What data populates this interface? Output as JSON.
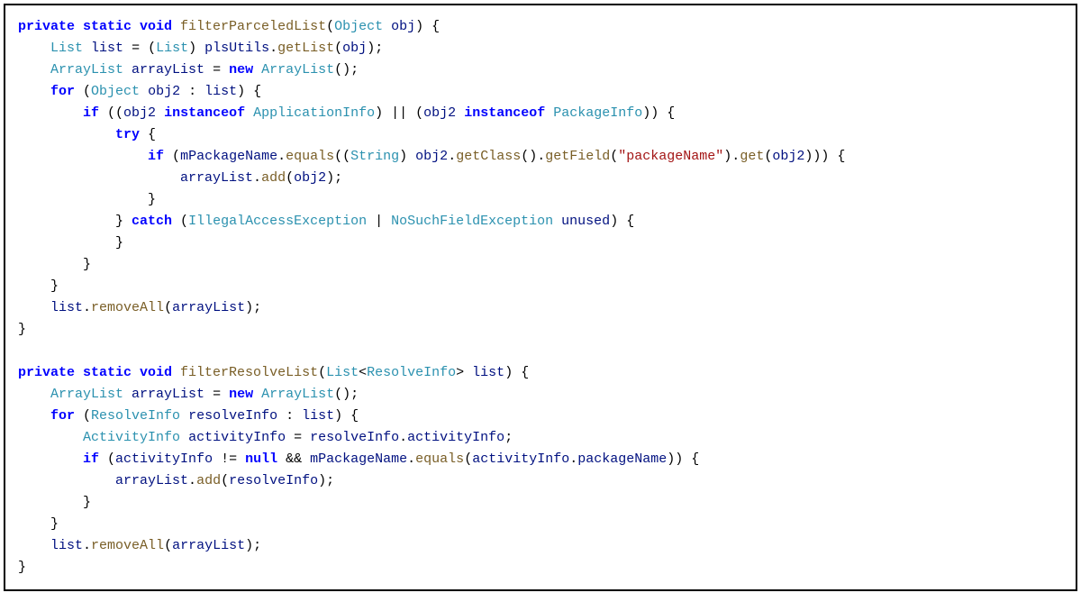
{
  "code": {
    "method1": {
      "modifiers": "private static void",
      "name": "filterParceledList",
      "param_type": "Object",
      "param_name": "obj",
      "line1_type1": "List",
      "line1_var": "list",
      "line1_cast": "List",
      "line1_call": "plsUtils",
      "line1_method": "getList",
      "line1_arg": "obj",
      "line2_type": "ArrayList",
      "line2_var": "arrayList",
      "line2_new": "new",
      "line2_ctor": "ArrayList",
      "for_kw": "for",
      "for_type": "Object",
      "for_var": "obj2",
      "for_in": "list",
      "if1_kw": "if",
      "if1_var1": "obj2",
      "if1_inst": "instanceof",
      "if1_type1": "ApplicationInfo",
      "if1_var2": "obj2",
      "if1_type2": "PackageInfo",
      "try_kw": "try",
      "if2_kw": "if",
      "if2_field": "mPackageName",
      "if2_method1": "equals",
      "if2_cast": "String",
      "if2_var": "obj2",
      "if2_method2": "getClass",
      "if2_method3": "getField",
      "if2_str": "\"packageName\"",
      "if2_method4": "get",
      "if2_arg": "obj2",
      "add_var": "arrayList",
      "add_method": "add",
      "add_arg": "obj2",
      "catch_kw": "catch",
      "catch_ex1": "IllegalAccessException",
      "catch_ex2": "NoSuchFieldException",
      "catch_var": "unused",
      "remove_var": "list",
      "remove_method": "removeAll",
      "remove_arg": "arrayList"
    },
    "method2": {
      "modifiers": "private static void",
      "name": "filterResolveList",
      "param_type": "List",
      "param_gen": "ResolveInfo",
      "param_name": "list",
      "line1_type": "ArrayList",
      "line1_var": "arrayList",
      "line1_new": "new",
      "line1_ctor": "ArrayList",
      "for_kw": "for",
      "for_type": "ResolveInfo",
      "for_var": "resolveInfo",
      "for_in": "list",
      "line2_type": "ActivityInfo",
      "line2_var": "activityInfo",
      "line2_src": "resolveInfo",
      "line2_field": "activityInfo",
      "if_kw": "if",
      "if_var1": "activityInfo",
      "if_null": "null",
      "if_field": "mPackageName",
      "if_method": "equals",
      "if_var2": "activityInfo",
      "if_prop": "packageName",
      "add_var": "arrayList",
      "add_method": "add",
      "add_arg": "resolveInfo",
      "remove_var": "list",
      "remove_method": "removeAll",
      "remove_arg": "arrayList"
    }
  }
}
